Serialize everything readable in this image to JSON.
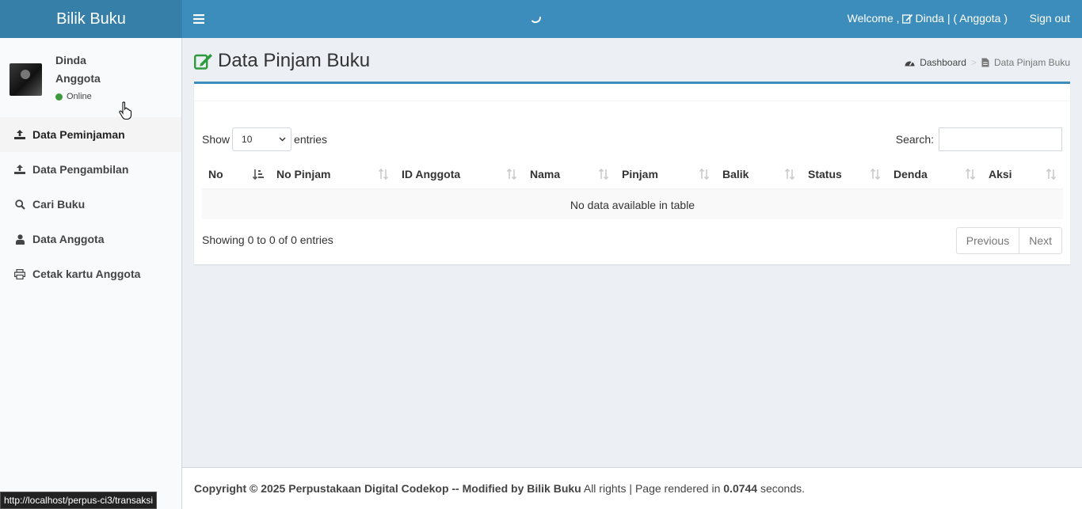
{
  "header": {
    "logo": "Bilik Buku",
    "welcome_prefix": "Welcome ,",
    "welcome_user": "Dinda | ( Anggota )",
    "signout": "Sign out"
  },
  "sidebar": {
    "user": {
      "name": "Dinda",
      "role": "Anggota",
      "status": "Online"
    },
    "items": [
      {
        "label": "Data Peminjaman",
        "icon": "upload-icon"
      },
      {
        "label": "Data Pengambilan",
        "icon": "upload-icon"
      },
      {
        "label": "Cari Buku",
        "icon": "search-icon"
      },
      {
        "label": "Data Anggota",
        "icon": "user-icon"
      },
      {
        "label": "Cetak kartu Anggota",
        "icon": "print-icon"
      }
    ]
  },
  "page": {
    "title": "Data Pinjam Buku",
    "breadcrumb": {
      "home": "Dashboard",
      "current": "Data Pinjam Buku"
    }
  },
  "table": {
    "show_label": "Show",
    "entries_label": "entries",
    "page_size": "10",
    "search_label": "Search:",
    "columns": [
      "No",
      "No Pinjam",
      "ID Anggota",
      "Nama",
      "Pinjam",
      "Balik",
      "Status",
      "Denda",
      "Aksi"
    ],
    "empty_text": "No data available in table",
    "info": "Showing 0 to 0 of 0 entries",
    "prev": "Previous",
    "next": "Next"
  },
  "footer": {
    "copyright": "Copyright © 2025 Perpustakaan Digital Codekop -- Modified by Bilik Buku",
    "rights": " All rights | Page rendered in ",
    "time": "0.0744",
    "suffix": " seconds."
  },
  "statusbar": "http://localhost/perpus-ci3/transaksi",
  "colors": {
    "header": "#3c8dbc",
    "logo_bg": "#367fa9",
    "title_icon": "#2e9a3e"
  }
}
